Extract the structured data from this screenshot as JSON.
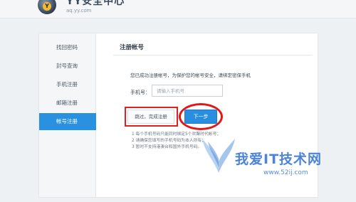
{
  "header": {
    "logo_letter": "Y",
    "title": "YY安全中心",
    "domain": "aq.yy.com"
  },
  "sidebar": {
    "items": [
      {
        "label": "找回密码",
        "active": false
      },
      {
        "label": "封号查询",
        "active": false
      },
      {
        "label": "手机注册",
        "active": false
      },
      {
        "label": "邮箱注册",
        "active": false
      },
      {
        "label": "帐号注册",
        "active": true
      }
    ]
  },
  "content": {
    "title": "注册帐号",
    "notice": "您已成功注册帐号，为保护您的帐号安全，请绑定密保手机",
    "phone_label": "手机号：",
    "phone_placeholder": "请输入手机号",
    "phone_value": "",
    "skip_label": "跳过，完成注册",
    "next_label": "下一步",
    "tips": [
      "1 每个手机号码只能同时绑定5个欢聚时代帐号；",
      "2 请确保您填写的手机号码为本人所有；",
      "3 暂时不支持港澳台和国外手机号码。"
    ]
  },
  "watermark": {
    "text": "我爱IT技术网",
    "url": "www.52ij.com"
  },
  "colors": {
    "accent": "#2a8ee0",
    "annotation": "#e02020"
  }
}
